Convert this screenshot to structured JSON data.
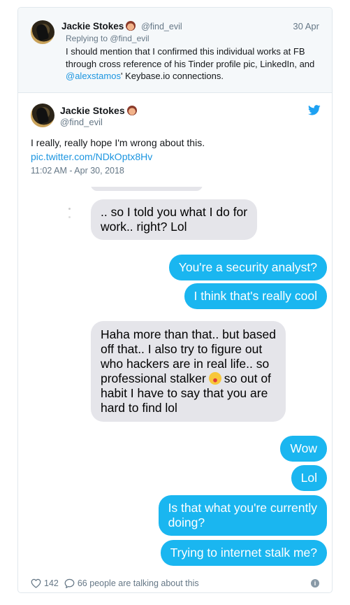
{
  "reply": {
    "author_name": "Jackie Stokes",
    "author_handle": "@find_evil",
    "date": "30 Apr",
    "replying_to": "Replying to @find_evil",
    "text_1": "I should mention that I confirmed this individual works at FB through cross reference of his Tinder profile pic, LinkedIn, and ",
    "text_link": "@alexstamos",
    "text_2": "' Keybase.io connections."
  },
  "tweet": {
    "author_name": "Jackie Stokes",
    "author_handle": "@find_evil",
    "text": "I really, really hope I'm wrong about this.",
    "link": "pic.twitter.com/NDkOptx8Hv",
    "timestamp": "11:02 AM - Apr 30, 2018"
  },
  "chat": {
    "m1": ".. so I told you what I do for",
    "m1b": "work.. right? Lol",
    "m2": "You're a security analyst?",
    "m3": "I think that's really cool",
    "m4a": "Haha more than that.. but based",
    "m4b": "off that.. I also try to figure out",
    "m4c": "who hackers are in real life.. so",
    "m4d": "professional stalker",
    "m4d2": "so out of",
    "m4e": "habit I have to say that you are",
    "m4f": "hard to find lol",
    "m5": "Wow",
    "m6": "Lol",
    "m7a": "Is that what you're currently",
    "m7b": "doing?",
    "m8": "Trying to internet stalk me?"
  },
  "footer": {
    "likes": "142",
    "talking": "66 people are talking about this"
  },
  "colors": {
    "link": "#1b95e0",
    "outgoing_bubble": "#1ab6f0",
    "incoming_bubble": "#e5e5ea"
  }
}
